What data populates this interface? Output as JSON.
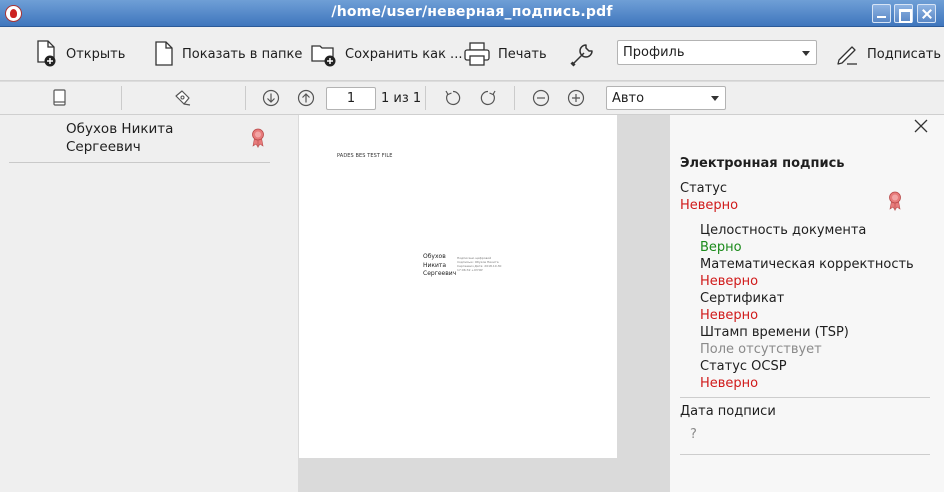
{
  "window": {
    "title": "/home/user/неверная_подпись.pdf"
  },
  "toolbar": {
    "open_label": "Открыть",
    "show_in_folder_label": "Показать в папке",
    "save_as_label": "Сохранить как ...",
    "print_label": "Печать",
    "profile_value": "Профиль",
    "sign_label": "Подписать"
  },
  "nav": {
    "page_number": "1",
    "page_count": "1 из 1",
    "zoom_value": "Авто"
  },
  "sidebar": {
    "signer_name": "Обухов Никита Сергеевич"
  },
  "document": {
    "header_text": "PADES BES TEST FILE",
    "stamp_name": "Обухов Никита Сергеевич",
    "stamp_details": "Подписано цифровой подписью: Обухов Никита Сергеевич Дата: 2018.10.30 17:06:32 +03'00'"
  },
  "panel": {
    "title": "Электронная подпись",
    "status_label": "Статус",
    "status_value": "Неверно",
    "checks": [
      {
        "label": "Целостность документа",
        "value": "Верно"
      },
      {
        "label": "Математическая корректность",
        "value": "Неверно"
      },
      {
        "label": "Сертификат",
        "value": "Неверно"
      },
      {
        "label": "Штамп времени (TSP)",
        "value": "Поле отсутствует"
      },
      {
        "label": "Статус OCSP",
        "value": "Неверно"
      }
    ],
    "date_label": "Дата подписи",
    "date_value": "?"
  },
  "colors": {
    "valid": "#1a8a1a",
    "invalid": "#d01a1a",
    "missing": "#8a8a8a",
    "badge": "#e77b7b"
  }
}
